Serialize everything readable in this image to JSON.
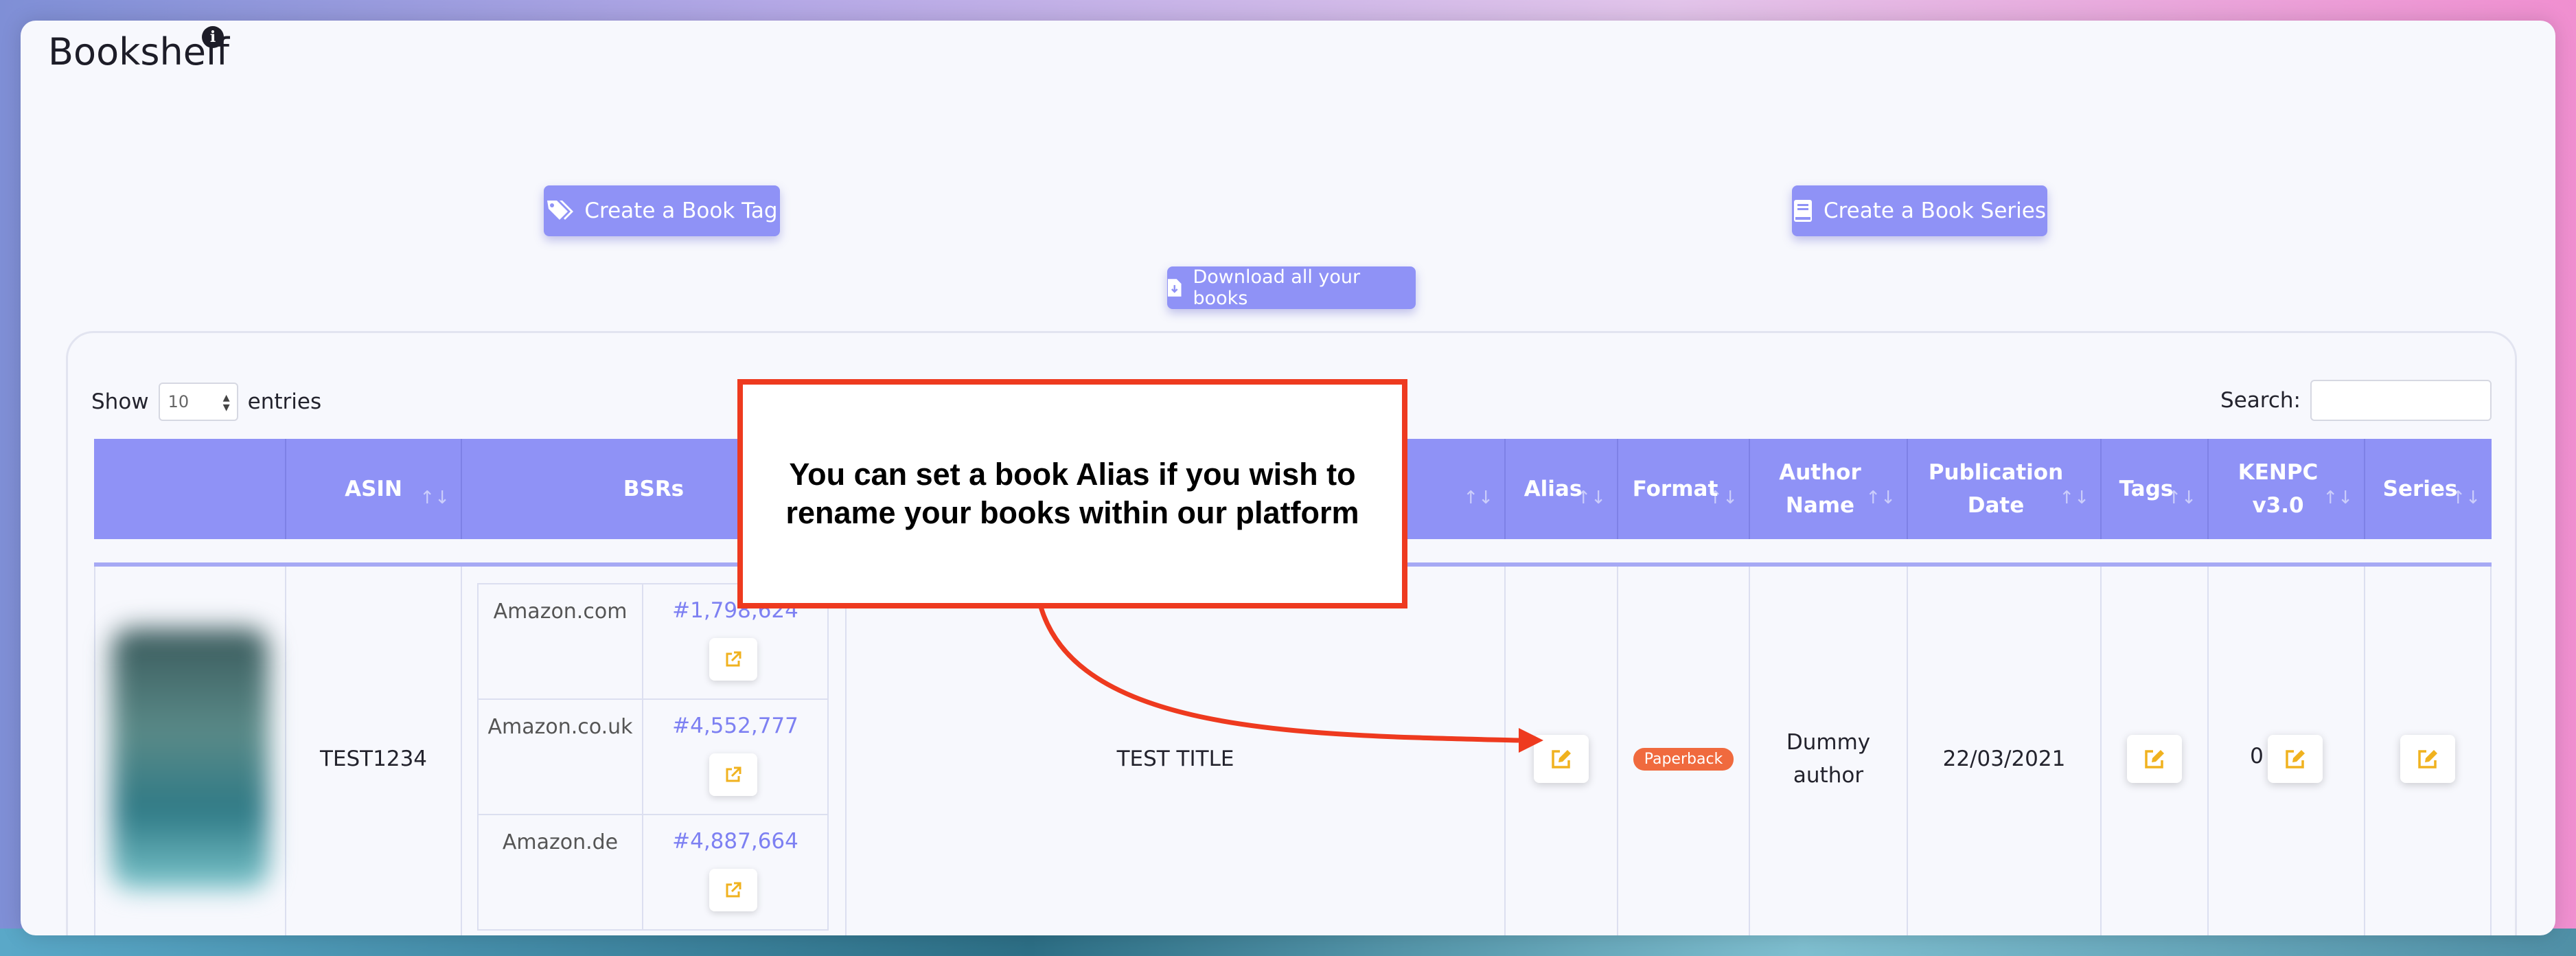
{
  "page": {
    "title": "Bookshelf"
  },
  "toolbar": {
    "create_tag_label": "Create a Book Tag",
    "create_series_label": "Create a Book Series",
    "download_label": "Download all your books"
  },
  "table_controls": {
    "show_label": "Show",
    "page_size": "10",
    "entries_label": "entries",
    "search_label": "Search:"
  },
  "columns": {
    "asin": "ASIN",
    "bsrs": "BSRs",
    "alias": "Alias",
    "format": "Format",
    "author": "Author Name",
    "publication": "Publication Date",
    "tags": "Tags",
    "kenpc": "KENPC v3.0",
    "series": "Series"
  },
  "row": {
    "asin": "TEST1234",
    "bsrs": [
      {
        "market": "Amazon.com",
        "rank": "#1,798,624"
      },
      {
        "market": "Amazon.co.uk",
        "rank": "#4,552,777"
      },
      {
        "market": "Amazon.de",
        "rank": "#4,887,664"
      }
    ],
    "title": "TEST TITLE",
    "format": "Paperback",
    "author": "Dummy author",
    "publication_date": "22/03/2021",
    "kenpc": "0"
  },
  "callout": {
    "text": "You can set a book Alias if you wish to rename your books within our platform"
  },
  "colors": {
    "accent": "#8f92f6",
    "callout_red": "#ee3a1f",
    "edit_icon": "#f0b21f",
    "badge": "#f06a3e"
  }
}
